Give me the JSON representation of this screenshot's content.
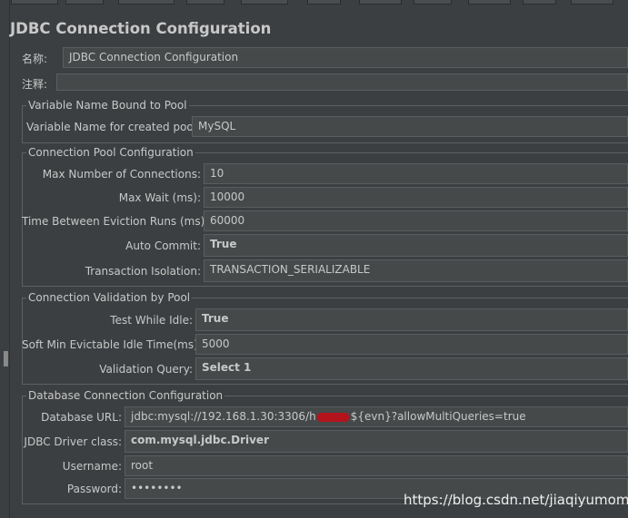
{
  "title": "JDBC Connection Configuration",
  "name_label": "名称:",
  "name_value": "JDBC Connection Configuration",
  "comment_label": "注释:",
  "comment_value": "",
  "variable_group": {
    "legend": "Variable Name Bound to Pool",
    "pool_label": "Variable Name for created pool:",
    "pool_value": "MySQL"
  },
  "pool_group": {
    "legend": "Connection Pool Configuration",
    "max_conn_label": "Max Number of Connections:",
    "max_conn_value": "10",
    "max_wait_label": "Max Wait (ms):",
    "max_wait_value": "10000",
    "eviction_label": "Time Between Eviction Runs (ms):",
    "eviction_value": "60000",
    "auto_commit_label": "Auto Commit:",
    "auto_commit_value": "True",
    "isolation_label": "Transaction Isolation:",
    "isolation_value": "TRANSACTION_SERIALIZABLE"
  },
  "validation_group": {
    "legend": "Connection Validation by Pool",
    "test_idle_label": "Test While Idle:",
    "test_idle_value": "True",
    "soft_min_label": "Soft Min Evictable Idle Time(ms):",
    "soft_min_value": "5000",
    "query_label": "Validation Query:",
    "query_value": "Select 1"
  },
  "db_group": {
    "legend": "Database Connection Configuration",
    "url_label": "Database URL:",
    "url_prefix": "jdbc:mysql://192.168.1.30:3306/h",
    "url_suffix": "${evn}?allowMultiQueries=true",
    "driver_label": "JDBC Driver class:",
    "driver_value": "com.mysql.jdbc.Driver",
    "user_label": "Username:",
    "user_value": "root",
    "password_label": "Password:",
    "password_value": "••••••••"
  },
  "watermark": "https://blog.csdn.net/jiaqiyumomo"
}
